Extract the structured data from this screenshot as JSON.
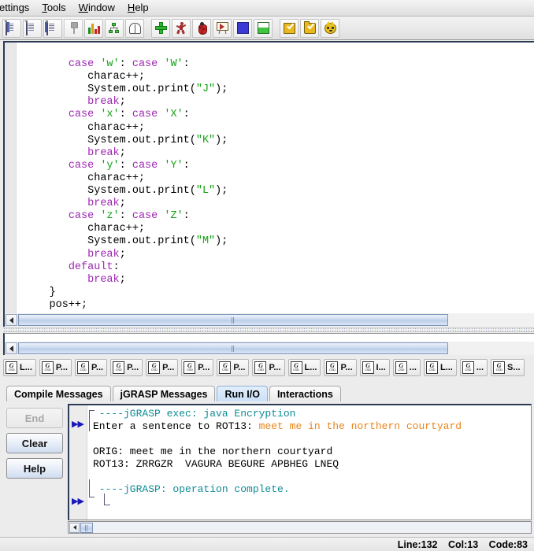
{
  "window": {
    "menubar": [
      {
        "name": "settings",
        "prefix": "",
        "mnemonic": "",
        "text": "ettings"
      },
      {
        "name": "tools",
        "prefix": "",
        "mnemonic": "T",
        "text": "ools"
      },
      {
        "name": "window",
        "prefix": "",
        "mnemonic": "W",
        "text": "indow"
      },
      {
        "name": "help",
        "prefix": "",
        "mnemonic": "H",
        "text": "elp"
      }
    ]
  },
  "toolbar": {
    "buttons": [
      {
        "icon": "new-csd-document-icon",
        "label": ""
      },
      {
        "icon": "new-plain-document-icon",
        "label": ""
      },
      {
        "icon": "new-other-document-icon",
        "label": ""
      },
      {
        "icon": "pin-icon",
        "label": ""
      },
      {
        "icon": "bar-chart-icon",
        "label": ""
      },
      {
        "icon": "class-tree-icon",
        "label": ""
      },
      {
        "icon": "open-book-icon",
        "label": ""
      },
      {
        "icon": "green-plus-icon",
        "label": ""
      },
      {
        "icon": "run-person-icon",
        "label": ""
      },
      {
        "icon": "debug-bug-icon",
        "label": ""
      },
      {
        "icon": "presentation-easel-icon",
        "label": ""
      },
      {
        "icon": "blue-square-icon",
        "label": ""
      },
      {
        "icon": "green-split-square-icon",
        "label": ""
      },
      {
        "icon": "check-document-icon",
        "label": ""
      },
      {
        "icon": "check-folder-icon",
        "label": ""
      },
      {
        "icon": "cat-face-icon",
        "label": ""
      }
    ]
  },
  "editor": {
    "code_lines": [
      {
        "indent": 0,
        "segments": []
      },
      {
        "indent": 0,
        "segments": [
          {
            "t": "        ",
            "c": "plain"
          },
          {
            "t": "case",
            "c": "kw"
          },
          {
            "t": " ",
            "c": "plain"
          },
          {
            "t": "'w'",
            "c": "str"
          },
          {
            "t": ": ",
            "c": "plain"
          },
          {
            "t": "case",
            "c": "kw"
          },
          {
            "t": " ",
            "c": "plain"
          },
          {
            "t": "'W'",
            "c": "str"
          },
          {
            "t": ":",
            "c": "plain"
          }
        ]
      },
      {
        "indent": 0,
        "segments": [
          {
            "t": "           charac++;",
            "c": "plain"
          }
        ]
      },
      {
        "indent": 0,
        "segments": [
          {
            "t": "           System.out.print(",
            "c": "plain"
          },
          {
            "t": "\"J\"",
            "c": "str"
          },
          {
            "t": ");",
            "c": "plain"
          }
        ]
      },
      {
        "indent": 0,
        "segments": [
          {
            "t": "           ",
            "c": "plain"
          },
          {
            "t": "break",
            "c": "kw"
          },
          {
            "t": ";",
            "c": "plain"
          }
        ]
      },
      {
        "indent": 0,
        "segments": [
          {
            "t": "        ",
            "c": "plain"
          },
          {
            "t": "case",
            "c": "kw"
          },
          {
            "t": " ",
            "c": "plain"
          },
          {
            "t": "'x'",
            "c": "str"
          },
          {
            "t": ": ",
            "c": "plain"
          },
          {
            "t": "case",
            "c": "kw"
          },
          {
            "t": " ",
            "c": "plain"
          },
          {
            "t": "'X'",
            "c": "str"
          },
          {
            "t": ":",
            "c": "plain"
          }
        ]
      },
      {
        "indent": 0,
        "segments": [
          {
            "t": "           charac++;",
            "c": "plain"
          }
        ]
      },
      {
        "indent": 0,
        "segments": [
          {
            "t": "           System.out.print(",
            "c": "plain"
          },
          {
            "t": "\"K\"",
            "c": "str"
          },
          {
            "t": ");",
            "c": "plain"
          }
        ]
      },
      {
        "indent": 0,
        "segments": [
          {
            "t": "           ",
            "c": "plain"
          },
          {
            "t": "break",
            "c": "kw"
          },
          {
            "t": ";",
            "c": "plain"
          }
        ]
      },
      {
        "indent": 0,
        "segments": [
          {
            "t": "        ",
            "c": "plain"
          },
          {
            "t": "case",
            "c": "kw"
          },
          {
            "t": " ",
            "c": "plain"
          },
          {
            "t": "'y'",
            "c": "str"
          },
          {
            "t": ": ",
            "c": "plain"
          },
          {
            "t": "case",
            "c": "kw"
          },
          {
            "t": " ",
            "c": "plain"
          },
          {
            "t": "'Y'",
            "c": "str"
          },
          {
            "t": ":",
            "c": "plain"
          }
        ]
      },
      {
        "indent": 0,
        "segments": [
          {
            "t": "           charac++;",
            "c": "plain"
          }
        ]
      },
      {
        "indent": 0,
        "segments": [
          {
            "t": "           System.out.print(",
            "c": "plain"
          },
          {
            "t": "\"L\"",
            "c": "str"
          },
          {
            "t": ");",
            "c": "plain"
          }
        ]
      },
      {
        "indent": 0,
        "segments": [
          {
            "t": "           ",
            "c": "plain"
          },
          {
            "t": "break",
            "c": "kw"
          },
          {
            "t": ";",
            "c": "plain"
          }
        ]
      },
      {
        "indent": 0,
        "segments": [
          {
            "t": "        ",
            "c": "plain"
          },
          {
            "t": "case",
            "c": "kw"
          },
          {
            "t": " ",
            "c": "plain"
          },
          {
            "t": "'z'",
            "c": "str"
          },
          {
            "t": ": ",
            "c": "plain"
          },
          {
            "t": "case",
            "c": "kw"
          },
          {
            "t": " ",
            "c": "plain"
          },
          {
            "t": "'Z'",
            "c": "str"
          },
          {
            "t": ":",
            "c": "plain"
          }
        ]
      },
      {
        "indent": 0,
        "segments": [
          {
            "t": "           charac++;",
            "c": "plain"
          }
        ]
      },
      {
        "indent": 0,
        "segments": [
          {
            "t": "           System.out.print(",
            "c": "plain"
          },
          {
            "t": "\"M\"",
            "c": "str"
          },
          {
            "t": ");",
            "c": "plain"
          }
        ]
      },
      {
        "indent": 0,
        "segments": [
          {
            "t": "           ",
            "c": "plain"
          },
          {
            "t": "break",
            "c": "kw"
          },
          {
            "t": ";",
            "c": "plain"
          }
        ]
      },
      {
        "indent": 0,
        "segments": [
          {
            "t": "        ",
            "c": "plain"
          },
          {
            "t": "default",
            "c": "kw"
          },
          {
            "t": ":",
            "c": "plain"
          }
        ]
      },
      {
        "indent": 0,
        "segments": [
          {
            "t": "           ",
            "c": "plain"
          },
          {
            "t": "break",
            "c": "kw"
          },
          {
            "t": ";",
            "c": "plain"
          }
        ]
      },
      {
        "indent": 0,
        "segments": [
          {
            "t": "     }",
            "c": "plain"
          }
        ]
      },
      {
        "indent": 0,
        "segments": [
          {
            "t": "     pos++;",
            "c": "plain"
          }
        ]
      }
    ]
  },
  "file_tabs": [
    {
      "icon": "jgrasp-csd-file-icon",
      "label": "L..."
    },
    {
      "icon": "jgrasp-csd-file-icon",
      "label": "P..."
    },
    {
      "icon": "jgrasp-csd-file-icon",
      "label": "P..."
    },
    {
      "icon": "jgrasp-csd-file-icon",
      "label": "P..."
    },
    {
      "icon": "jgrasp-csd-file-icon",
      "label": "P..."
    },
    {
      "icon": "jgrasp-csd-file-icon",
      "label": "P..."
    },
    {
      "icon": "jgrasp-csd-file-icon",
      "label": "P..."
    },
    {
      "icon": "jgrasp-csd-file-icon",
      "label": "P..."
    },
    {
      "icon": "jgrasp-csd-file-icon",
      "label": "L..."
    },
    {
      "icon": "jgrasp-csd-file-icon",
      "label": "P..."
    },
    {
      "icon": "jgrasp-csd-file-icon",
      "label": "I..."
    },
    {
      "icon": "jgrasp-csd-file-icon",
      "label": "..."
    },
    {
      "icon": "jgrasp-csd-file-icon",
      "label": "L..."
    },
    {
      "icon": "jgrasp-csd-file-icon",
      "label": "..."
    },
    {
      "icon": "jgrasp-csd-file-icon",
      "label": "S..."
    }
  ],
  "message_tabs": [
    {
      "label": "Compile Messages",
      "selected": false
    },
    {
      "label": "jGRASP Messages",
      "selected": false
    },
    {
      "label": "Run I/O",
      "selected": true
    },
    {
      "label": "Interactions",
      "selected": false
    }
  ],
  "run_io": {
    "buttons": [
      {
        "label": "End",
        "enabled": false
      },
      {
        "label": "Clear",
        "enabled": true
      },
      {
        "label": "Help",
        "enabled": true
      }
    ],
    "lines": [
      {
        "segments": [
          {
            "t": " ----jGRASP exec: java Encryption",
            "c": "teal"
          }
        ]
      },
      {
        "segments": [
          {
            "t": "Enter a sentence to ROT13: ",
            "c": "plain"
          },
          {
            "t": "meet me in the northern courtyard",
            "c": "orange"
          }
        ]
      },
      {
        "segments": []
      },
      {
        "segments": [
          {
            "t": "ORIG: meet me in the northern courtyard",
            "c": "plain"
          }
        ]
      },
      {
        "segments": [
          {
            "t": "ROT13: ZRRGZR  VAGURA BEGURE APBHEG LNEQ",
            "c": "plain"
          }
        ]
      },
      {
        "segments": []
      },
      {
        "segments": [
          {
            "t": " ----jGRASP: operation complete.",
            "c": "teal"
          }
        ]
      }
    ]
  },
  "statusbar": {
    "line": "Line:132",
    "col": "Col:13",
    "code": "Code:83"
  },
  "colors": {
    "keyword": "#9c27b0",
    "string": "#13a313",
    "console_teal": "#0d8b96",
    "console_orange": "#e8851a",
    "tab_selected": "#c9e0f7",
    "editor_border": "#2b3a55"
  }
}
